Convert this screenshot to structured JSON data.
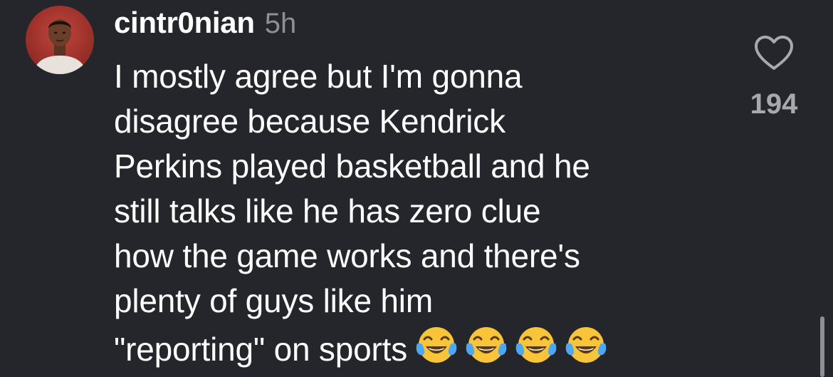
{
  "comment": {
    "username": "cintr0nian",
    "time_ago": "5h",
    "text_lines": [
      "I mostly agree but I'm gonna",
      "disagree because Kendrick",
      "Perkins played basketball and he",
      "still talks like he has zero clue",
      "how the game works and there's",
      "plenty of guys like him",
      "\"reporting\" on sports"
    ],
    "emoji": [
      "😂",
      "😂",
      "😂",
      "😂"
    ],
    "like_icon": "heart-outline-icon",
    "like_count": "194"
  },
  "colors": {
    "background": "#25262b",
    "text": "#ffffff",
    "secondary_text": "#8e8e93",
    "like_count": "#a8a9ad"
  }
}
